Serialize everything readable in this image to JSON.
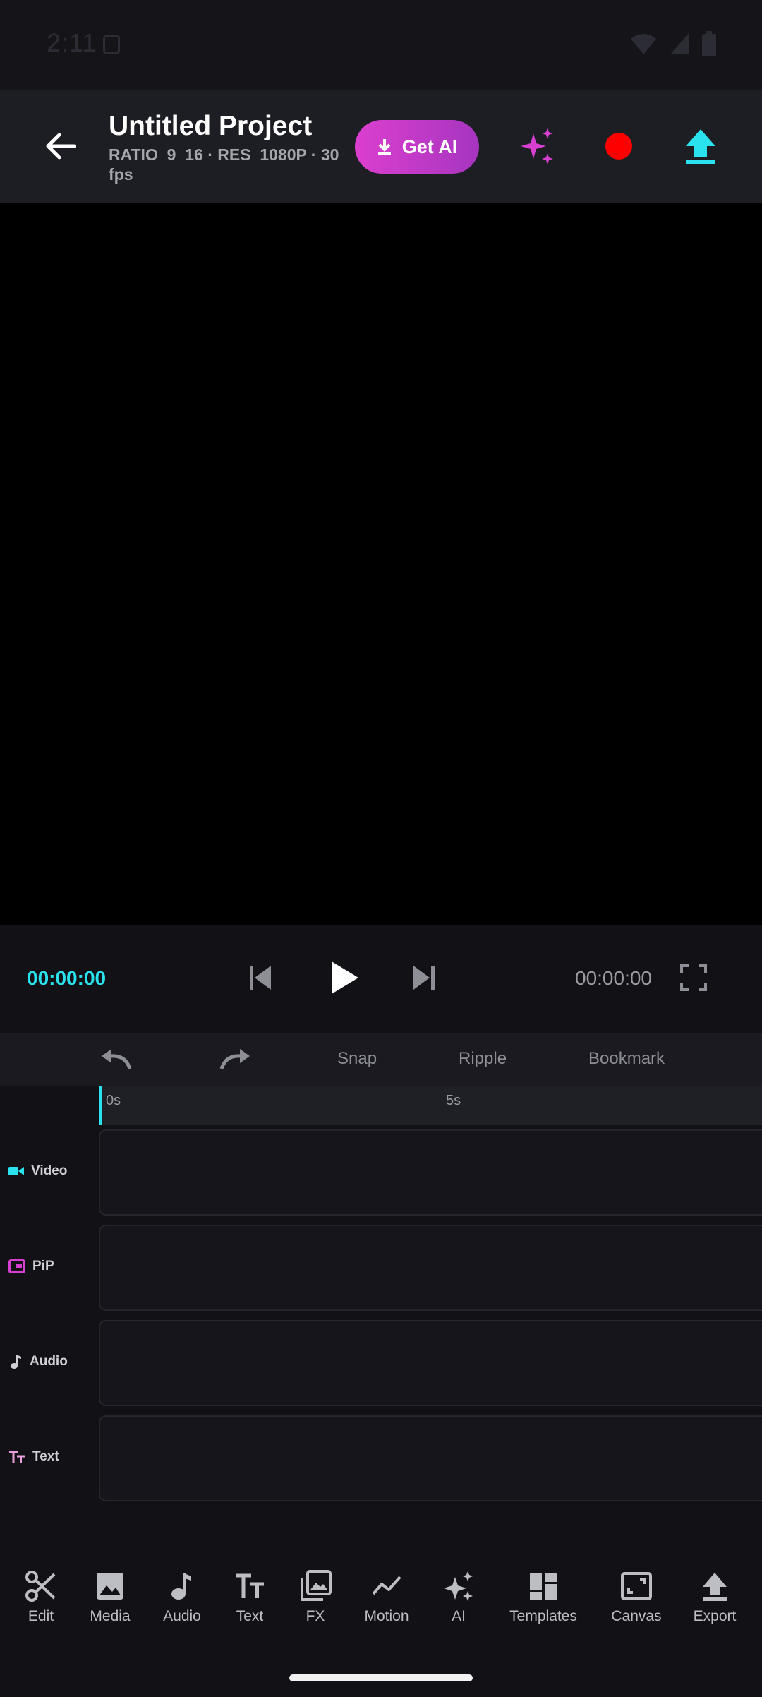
{
  "status_bar": {
    "time": "2:11"
  },
  "header": {
    "title": "Untitled Project",
    "subtitle": "RATIO_9_16 · RES_1080P · 30 fps",
    "get_ai_label": "Get AI"
  },
  "transport": {
    "current_time": "00:00:00",
    "total_time": "00:00:00"
  },
  "toolbar": {
    "snap": "Snap",
    "ripple": "Ripple",
    "bookmark": "Bookmark"
  },
  "ruler": {
    "marks": [
      "0s",
      "5s"
    ]
  },
  "tracks": [
    {
      "label": "Video",
      "icon": "video-camera-icon"
    },
    {
      "label": "PiP",
      "icon": "pip-icon"
    },
    {
      "label": "Audio",
      "icon": "music-note-icon"
    },
    {
      "label": "Text",
      "icon": "text-icon"
    }
  ],
  "bottom_nav": [
    {
      "label": "Edit",
      "icon": "scissors-icon"
    },
    {
      "label": "Media",
      "icon": "image-icon"
    },
    {
      "label": "Audio",
      "icon": "music-note-icon"
    },
    {
      "label": "Text",
      "icon": "text-icon"
    },
    {
      "label": "FX",
      "icon": "fx-icon"
    },
    {
      "label": "Motion",
      "icon": "motion-icon"
    },
    {
      "label": "AI",
      "icon": "sparkle-icon"
    },
    {
      "label": "Templates",
      "icon": "templates-icon"
    },
    {
      "label": "Canvas",
      "icon": "canvas-icon"
    },
    {
      "label": "Export",
      "icon": "upload-icon"
    }
  ],
  "colors": {
    "accent_cyan": "#2ae2ee",
    "accent_magenta": "#d63fd0",
    "record_red": "#ff0000",
    "background": "#111116"
  }
}
